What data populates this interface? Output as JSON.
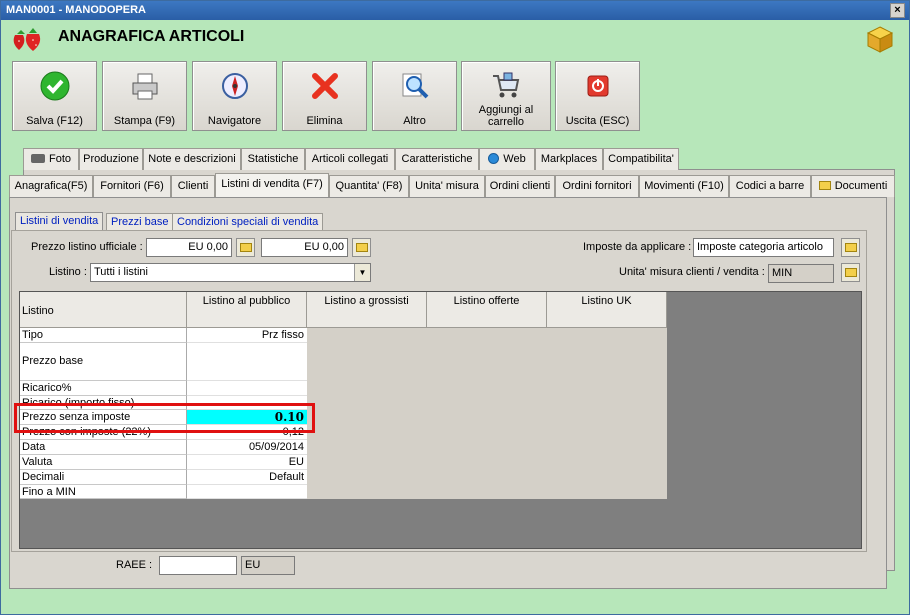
{
  "window": {
    "title": "MAN0001 - MANODOPERA",
    "close": "×"
  },
  "app": {
    "title": "ANAGRAFICA ARTICOLI"
  },
  "toolbar": [
    {
      "label": "Salva (F12)",
      "icon": "check-icon"
    },
    {
      "label": "Stampa (F9)",
      "icon": "printer-icon"
    },
    {
      "label": "Navigatore",
      "icon": "compass-icon"
    },
    {
      "label": "Elimina",
      "icon": "delete-x-icon"
    },
    {
      "label": "Altro",
      "icon": "magnifier-icon"
    },
    {
      "label": "Aggiungi al carrello",
      "icon": "cart-icon"
    },
    {
      "label": "Uscita (ESC)",
      "icon": "exit-icon"
    }
  ],
  "tabs_row1": [
    "Foto",
    "Produzione",
    "Note e descrizioni",
    "Statistiche",
    "Articoli collegati",
    "Caratteristiche",
    "Web",
    "Markplaces",
    "Compatibilita'"
  ],
  "tabs_row2": [
    "Anagrafica(F5)",
    "Fornitori (F6)",
    "Clienti",
    "Listini di vendita (F7)",
    "Quantita' (F8)",
    "Unita' misura",
    "Ordini clienti",
    "Ordini fornitori",
    "Movimenti (F10)",
    "Codici a barre",
    "Documenti"
  ],
  "subtabs": [
    "Listini di vendita",
    "Prezzi base",
    "Condizioni speciali di vendita"
  ],
  "form": {
    "prezzo_listino_label": "Prezzo listino ufficiale :",
    "prezzo1": "EU 0,00",
    "prezzo2": "EU 0,00",
    "listino_label": "Listino :",
    "listino_value": "Tutti i listini",
    "imposte_label": "Imposte da applicare :",
    "imposte_value": "Imposte categoria articolo",
    "um_label": "Unita' misura clienti / vendita :",
    "um_value": "MIN",
    "raee_label": "RAEE :",
    "raee_value": "",
    "raee_unit": "EU"
  },
  "grid": {
    "corner": "Listino",
    "columns": [
      "Listino al pubblico",
      "Listino a grossisti",
      "Listino offerte",
      "Listino UK"
    ],
    "rows": [
      {
        "label": "Tipo",
        "value": "Prz fisso"
      },
      {
        "label": "Prezzo base",
        "value": ""
      },
      {
        "label": "Ricarico%",
        "value": ""
      },
      {
        "label": "Ricarico (importo fisso)",
        "value": ""
      },
      {
        "label": "Prezzo senza imposte",
        "value": "0.10"
      },
      {
        "label": "Prezzo con imposte (22%)",
        "value": "0,12"
      },
      {
        "label": "Data",
        "value": "05/09/2014"
      },
      {
        "label": "Valuta",
        "value": "EU"
      },
      {
        "label": "Decimali",
        "value": "Default"
      },
      {
        "label": "Fino a MIN",
        "value": ""
      }
    ]
  },
  "colors": {
    "highlight": "#00ffff",
    "annotation": "#e01010",
    "background": "#b7e7ba"
  }
}
